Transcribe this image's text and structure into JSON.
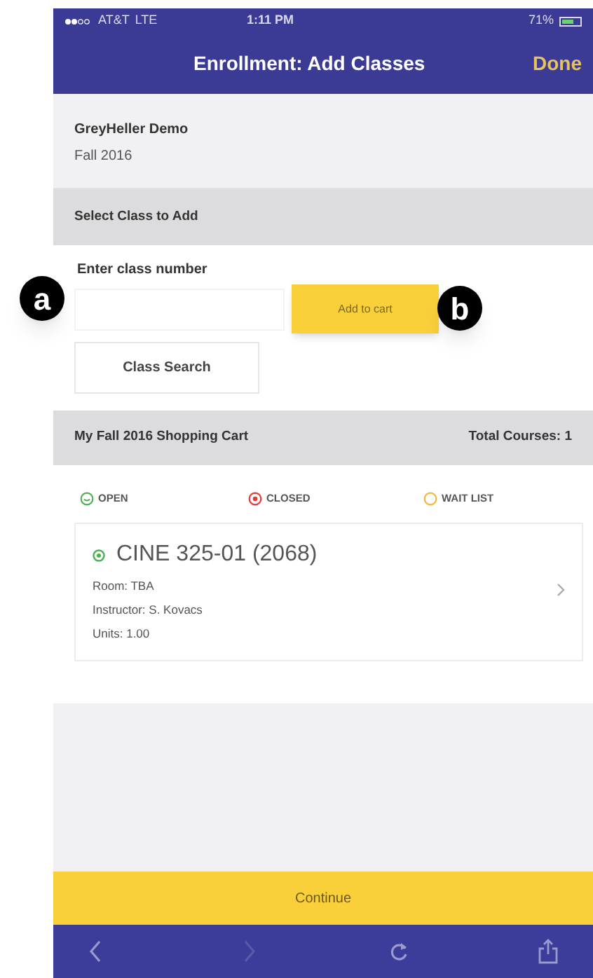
{
  "status_bar": {
    "carrier": "AT&T",
    "network": "LTE",
    "time": "1:11 PM",
    "battery": "71%"
  },
  "nav_bar": {
    "title": "Enrollment: Add Classes",
    "action": "Done"
  },
  "institution": {
    "name": "GreyHeller Demo",
    "term": "Fall 2016"
  },
  "add_section": {
    "header": "Select Class to Add",
    "field_label": "Enter class number",
    "add_button": "Add to cart",
    "search_button": "Class Search"
  },
  "cart": {
    "header": "My Fall 2016 Shopping Cart",
    "total": "Total Courses: 1",
    "legend": [
      {
        "kind": "open",
        "label": "OPEN",
        "color": "#4caf50"
      },
      {
        "kind": "closed",
        "label": "CLOSED",
        "color": "#e53935"
      },
      {
        "kind": "waitlist",
        "label": "WAIT LIST",
        "color": "#f5b342"
      }
    ],
    "classes": [
      {
        "color": "#4caf50",
        "title": "CINE 325-01 (2068)",
        "room": "Room: TBA",
        "instructor": "Instructor: S. Kovacs",
        "units": "Units: 1.00"
      }
    ]
  },
  "continue_button": "Continue",
  "annotations": [
    {
      "label": "a"
    },
    {
      "label": "b"
    }
  ]
}
